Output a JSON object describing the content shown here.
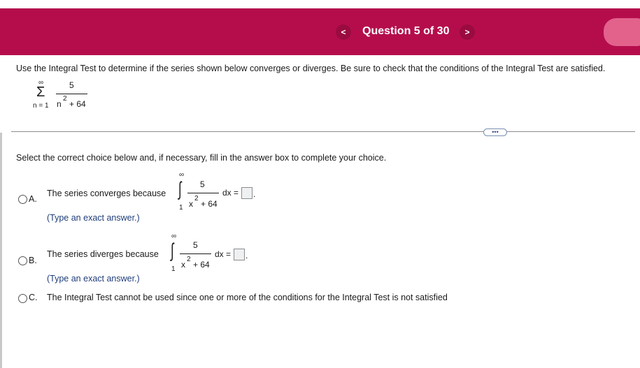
{
  "header": {
    "prev_label": "<",
    "next_label": ">",
    "title": "Question 5 of 30"
  },
  "question": {
    "prompt": "Use the Integral Test to determine if the series shown below converges or diverges. Be sure to check that the conditions of the Integral Test are satisfied.",
    "series": {
      "sigma": "Σ",
      "upper": "∞",
      "lower": "n = 1",
      "numerator": "5",
      "denominator_base": "n",
      "denominator_exp": "2",
      "denominator_rest": "+ 64"
    }
  },
  "more_button": "•••",
  "instruction": "Select the correct choice below and, if necessary, fill in the answer box to complete your choice.",
  "options": [
    {
      "letter": "A.",
      "text": "The series converges because",
      "hint": "(Type an exact answer.)",
      "integral": {
        "sign": "∫",
        "upper": "∞",
        "lower": "1",
        "numerator": "5",
        "denominator_base": "x",
        "denominator_exp": "2",
        "denominator_rest": "+ 64",
        "dx": "dx ="
      }
    },
    {
      "letter": "B.",
      "text": "The series diverges because",
      "hint": "(Type an exact answer.)",
      "integral": {
        "sign": "∫",
        "upper": "∞",
        "lower": "1",
        "numerator": "5",
        "denominator_base": "x",
        "denominator_exp": "2",
        "denominator_rest": "+ 64",
        "dx": "dx ="
      }
    },
    {
      "letter": "C.",
      "text": "The Integral Test cannot be used since one or more of the conditions for the Integral Test is not satisfied"
    }
  ],
  "period": "."
}
